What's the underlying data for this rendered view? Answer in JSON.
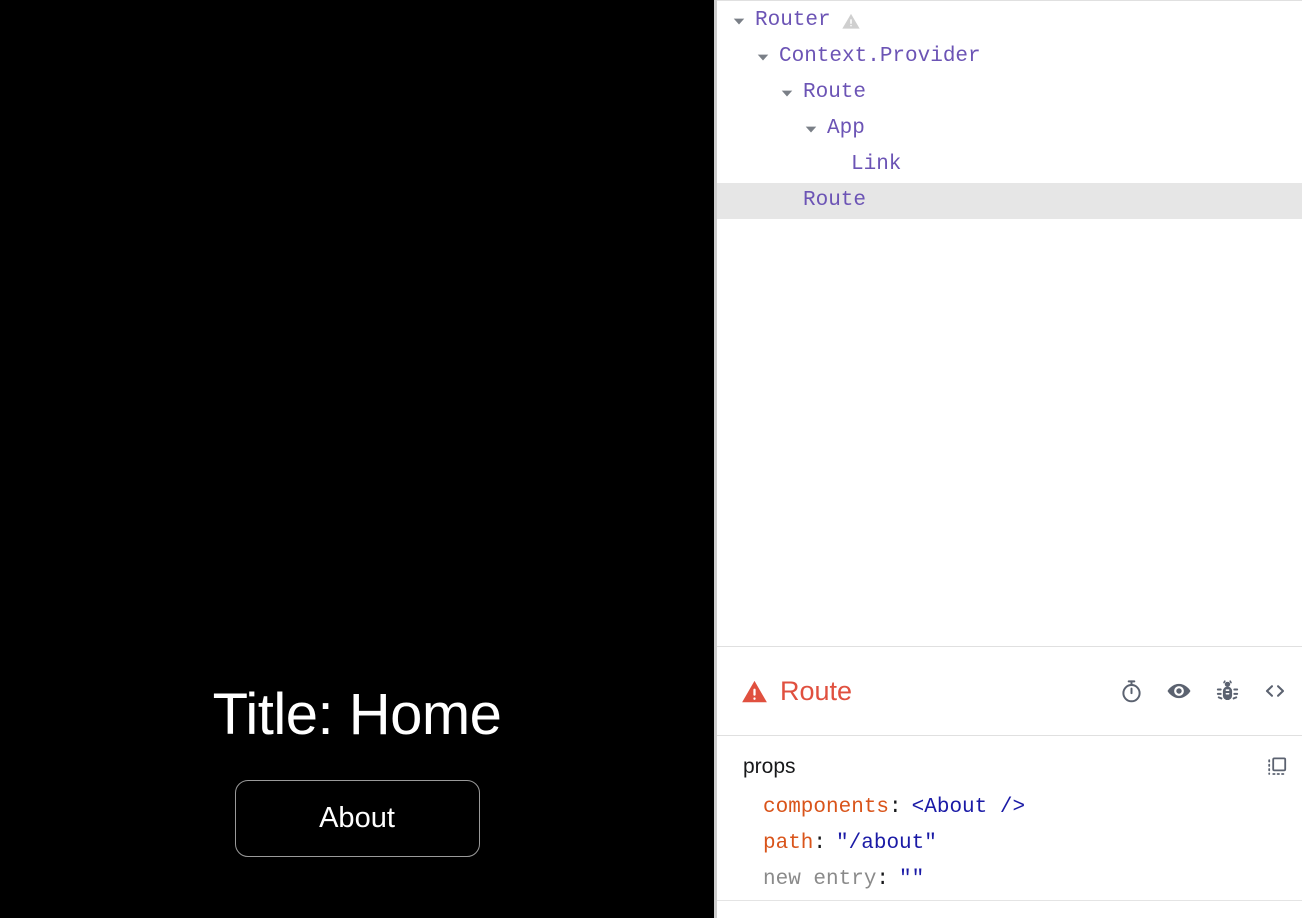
{
  "app": {
    "title": "Title: Home",
    "about_button_label": "About",
    "background_color": "#000000",
    "text_color": "#ffffff"
  },
  "devtools": {
    "tree": {
      "rows": [
        {
          "label": "Router",
          "depth": 0,
          "expanded": true,
          "has_arrow": true,
          "selected": false,
          "warning": true
        },
        {
          "label": "Context.Provider",
          "depth": 1,
          "expanded": true,
          "has_arrow": true,
          "selected": false,
          "warning": false
        },
        {
          "label": "Route",
          "depth": 2,
          "expanded": true,
          "has_arrow": true,
          "selected": false,
          "warning": false
        },
        {
          "label": "App",
          "depth": 3,
          "expanded": true,
          "has_arrow": true,
          "selected": false,
          "warning": false
        },
        {
          "label": "Link",
          "depth": 4,
          "expanded": false,
          "has_arrow": false,
          "selected": false,
          "warning": false
        },
        {
          "label": "Route",
          "depth": 2,
          "expanded": false,
          "has_arrow": false,
          "selected": true,
          "warning": false
        }
      ],
      "element_color": "#6c54b5",
      "selected_row_color": "#e6e6e6"
    },
    "inspector": {
      "component_name": "Route",
      "has_warning": true,
      "warning_color": "#e0503f",
      "actions": [
        {
          "name": "suspend-toggle-icon",
          "title": "Suspend"
        },
        {
          "name": "inspect-eye-icon",
          "title": "Inspect the matching DOM element"
        },
        {
          "name": "debug-bug-icon",
          "title": "Log this component data to the console"
        },
        {
          "name": "view-source-icon",
          "title": "View source for this element"
        }
      ]
    },
    "props": {
      "section_label": "props",
      "copy_icon_name": "copy-props-icon",
      "entries": [
        {
          "name": "components",
          "value": "<About />",
          "muted": false
        },
        {
          "name": "path",
          "value": "\"/about\"",
          "muted": false
        },
        {
          "name": "new entry",
          "value": "\"\"",
          "muted": true
        }
      ],
      "name_color": "#d9541a",
      "value_color": "#1a1aa6"
    }
  }
}
